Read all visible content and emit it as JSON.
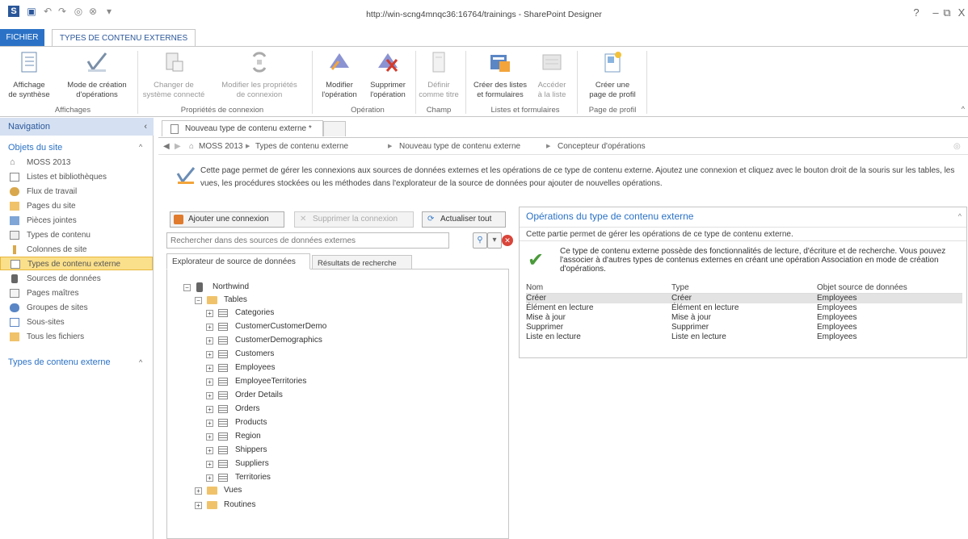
{
  "window": {
    "title": "http://win-scng4mnqc36:16764/trainings - SharePoint Designer",
    "controls": {
      "help": "?",
      "minimize": "–",
      "restore": "⧉",
      "close": "X"
    }
  },
  "ribbon_tabs": {
    "file": "FICHIER",
    "ect": "TYPES DE CONTENU EXTERNES"
  },
  "ribbon": {
    "buttons": [
      {
        "l1": "Affichage",
        "l2": "de synthèse"
      },
      {
        "l1": "Mode de création",
        "l2": "d'opérations"
      },
      {
        "l1": "Changer de",
        "l2": "système connecté"
      },
      {
        "l1": "Modifier les propriétés",
        "l2": "de connexion"
      },
      {
        "l1": "Modifier",
        "l2": "l'opération"
      },
      {
        "l1": "Supprimer",
        "l2": "l'opération"
      },
      {
        "l1": "Définir",
        "l2": "comme titre"
      },
      {
        "l1": "Créer des listes",
        "l2": "et formulaires"
      },
      {
        "l1": "Accéder",
        "l2": "à la liste"
      },
      {
        "l1": "Créer une",
        "l2": "page de profil"
      }
    ],
    "groups": {
      "affichages": "Affichages",
      "connexion": "Propriétés de connexion",
      "operation": "Opération",
      "champ": "Champ",
      "listes": "Listes et formulaires",
      "profil": "Page de profil"
    }
  },
  "nav": {
    "header": "Navigation",
    "section_site": "Objets du site",
    "items": [
      "MOSS 2013",
      "Listes et bibliothèques",
      "Flux de travail",
      "Pages du site",
      "Pièces jointes",
      "Types de contenu",
      "Colonnes de site",
      "Types de contenu externe",
      "Sources de données",
      "Pages maîtres",
      "Groupes de sites",
      "Sous-sites",
      "Tous les fichiers"
    ],
    "section_ect": "Types de contenu externe"
  },
  "doc_tab": "Nouveau type de contenu externe *",
  "breadcrumb": {
    "site": "MOSS 2013",
    "c1": "Types de contenu externe",
    "c2": "Nouveau type de contenu externe",
    "c3": "Concepteur d'opérations",
    "sep": "▶"
  },
  "info": {
    "text": "Cette page permet de gérer les connexions aux sources de données externes et les opérations de ce type de contenu externe. Ajoutez une connexion et cliquez avec le bouton droit de la souris sur les tables, les vues, les procédures stockées ou les méthodes dans l'explorateur de la source de données pour ajouter de nouvelles opérations."
  },
  "left_panel": {
    "add_connection": "Ajouter une connexion",
    "remove_connection": "Supprimer la connexion",
    "refresh_all": "Actualiser tout",
    "search_placeholder": "Rechercher dans des sources de données externes",
    "tab_explorer": "Explorateur de source de données",
    "tab_results": "Résultats de recherche"
  },
  "tree": {
    "root": "Northwind",
    "tables_label": "Tables",
    "tables": [
      "Categories",
      "CustomerCustomerDemo",
      "CustomerDemographics",
      "Customers",
      "Employees",
      "EmployeeTerritories",
      "Order Details",
      "Orders",
      "Products",
      "Region",
      "Shippers",
      "Suppliers",
      "Territories"
    ],
    "vues": "Vues",
    "routines": "Routines"
  },
  "ops_panel": {
    "title": "Opérations du type de contenu externe",
    "description": "Cette partie permet de gérer les opérations de ce type de contenu externe.",
    "message": "Ce type de contenu externe possède des fonctionnalités de lecture, d'écriture et de recherche. Vous pouvez l'associer à d'autres types de contenus externes en créant une opération Association en mode de création d'opérations.",
    "columns": [
      "Nom",
      "Type",
      "Objet source de données"
    ],
    "rows": [
      [
        "Créer",
        "Créer",
        "Employees"
      ],
      [
        "Élément en lecture",
        "Élément en lecture",
        "Employees"
      ],
      [
        "Mise à jour",
        "Mise à jour",
        "Employees"
      ],
      [
        "Supprimer",
        "Supprimer",
        "Employees"
      ],
      [
        "Liste en lecture",
        "Liste en lecture",
        "Employees"
      ]
    ]
  }
}
